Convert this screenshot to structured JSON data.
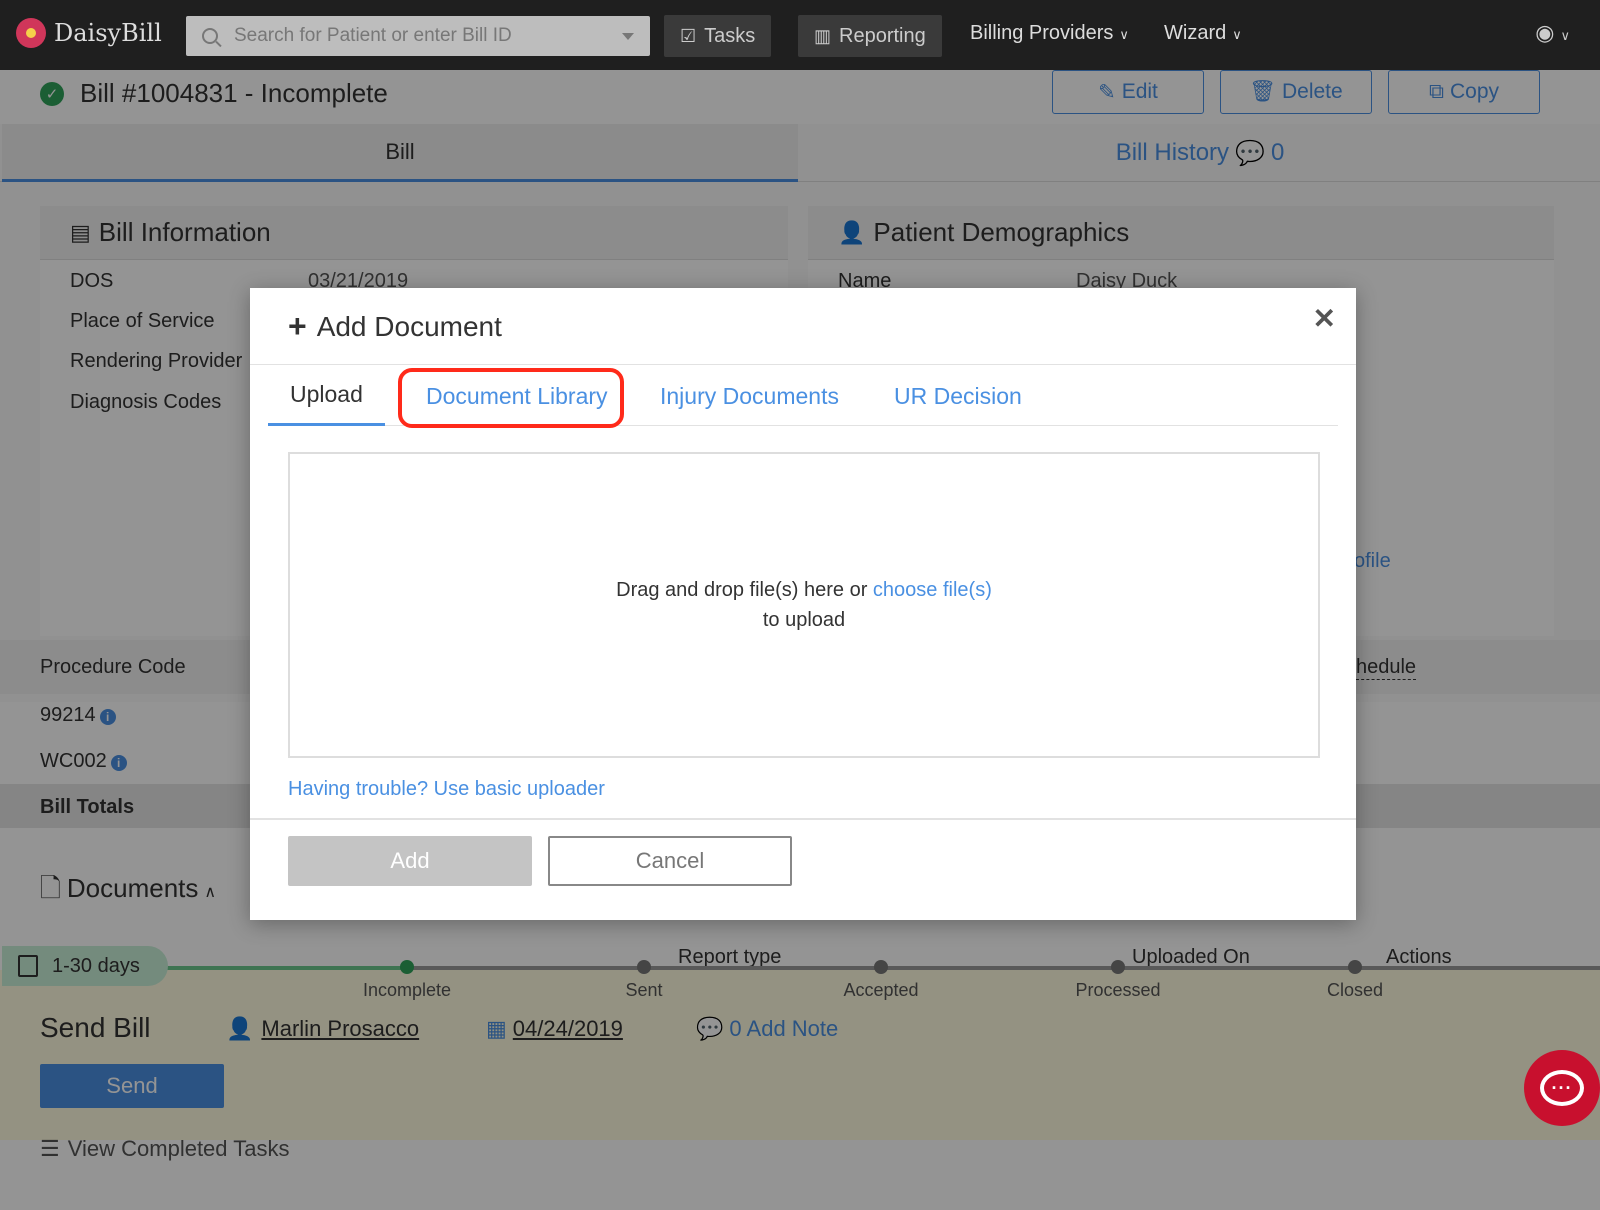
{
  "app": {
    "name": "DaisyBill"
  },
  "nav": {
    "search_placeholder": "Search for Patient or enter Bill ID",
    "tasks": "Tasks",
    "reporting": "Reporting",
    "billing_providers": "Billing Providers",
    "wizard": "Wizard"
  },
  "bill": {
    "title": "Bill #1004831 - Incomplete",
    "edit": "Edit",
    "delete": "Delete",
    "copy": "Copy",
    "tab_bill": "Bill",
    "tab_history": "Bill History",
    "history_count": "0"
  },
  "bill_info": {
    "header": "Bill Information",
    "dos_label": "DOS",
    "dos_value": "03/21/2019",
    "pos_label": "Place of Service",
    "rendering_label": "Rendering Provider",
    "diagnosis_label": "Diagnosis Codes"
  },
  "patient": {
    "header": "Patient Demographics",
    "name_label": "Name",
    "name_value": "Daisy Duck",
    "profile_fragment": "ofile"
  },
  "procedures": {
    "header": "Procedure Code",
    "schedule_fragment": "hedule",
    "codes": [
      "99214",
      "WC002"
    ],
    "totals": "Bill Totals"
  },
  "documents": {
    "title": "Documents",
    "col_report_type": "Report type",
    "col_uploaded_on": "Uploaded On",
    "col_actions": "Actions"
  },
  "task": {
    "days_badge": "1-30 days",
    "steps": [
      "Incomplete",
      "Sent",
      "Accepted",
      "Processed",
      "Closed"
    ],
    "send_title": "Send Bill",
    "assignee": "Marlin Prosacco",
    "date": "04/24/2019",
    "note": "0 Add Note",
    "send": "Send",
    "view_completed": "View Completed Tasks"
  },
  "modal": {
    "title": "Add Document",
    "tabs": [
      "Upload",
      "Document Library",
      "Injury Documents",
      "UR Decision"
    ],
    "drop_text": "Drag and drop file(s) here or",
    "choose_link": "choose file(s)",
    "drop_text2": "to upload",
    "trouble_link": "Having trouble? Use basic uploader",
    "add": "Add",
    "cancel": "Cancel"
  },
  "colors": {
    "accent": "#4a90e2",
    "highlight": "#ff2a1a",
    "success": "#2fa35a",
    "chat": "#c8102e"
  }
}
